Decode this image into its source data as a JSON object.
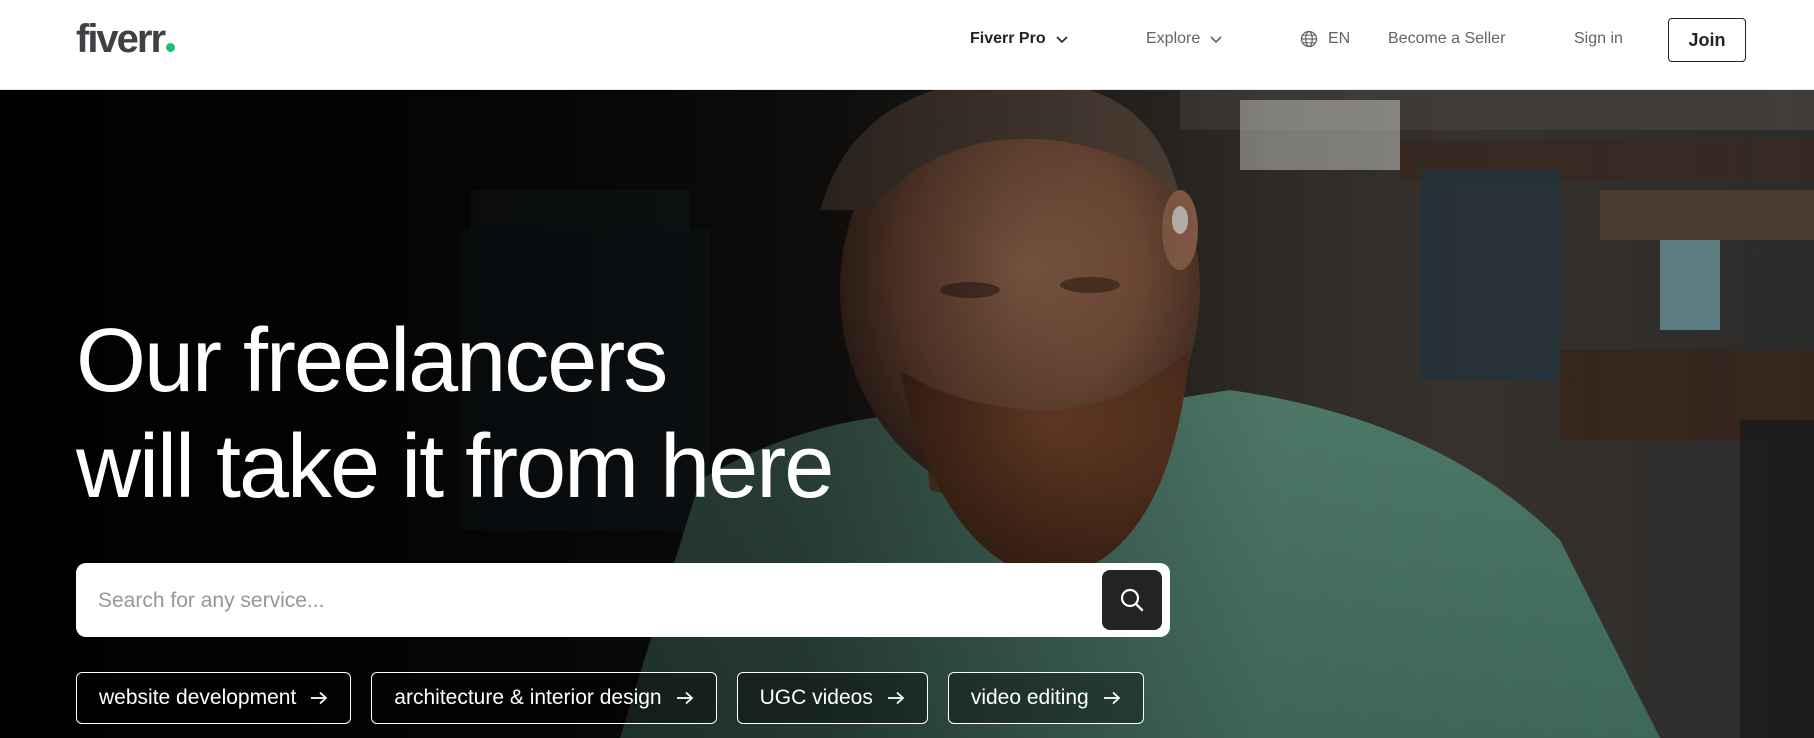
{
  "header": {
    "logo_text": "fiverr",
    "nav": {
      "fiverr_pro": "Fiverr Pro",
      "explore": "Explore",
      "language": "EN",
      "become_seller": "Become a Seller",
      "sign_in": "Sign in",
      "join": "Join"
    }
  },
  "hero": {
    "headline_line1": "Our freelancers",
    "headline_line2": "will take it from here",
    "search": {
      "placeholder": "Search for any service...",
      "value": ""
    },
    "popular": [
      {
        "label": "website development"
      },
      {
        "label": "architecture & interior design"
      },
      {
        "label": "UGC videos"
      },
      {
        "label": "video editing"
      }
    ]
  },
  "icons": {
    "chevron": "chevron-down-icon",
    "globe": "globe-icon",
    "search": "search-icon",
    "arrow": "arrow-right-icon"
  },
  "colors": {
    "brand_green": "#1dbf73",
    "text_dark": "#222325",
    "text_muted": "#62646a",
    "shirt_green": "#5a8a78"
  }
}
